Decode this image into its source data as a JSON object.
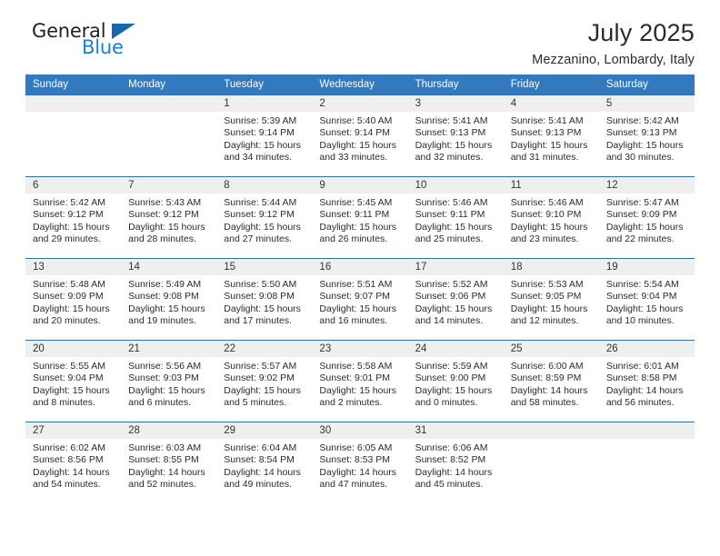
{
  "brand": {
    "name_top": "General",
    "name_bottom": "Blue",
    "triangle_color": "#1567b0",
    "blue_color": "#1c7fd0"
  },
  "header": {
    "title": "July 2025",
    "subtitle": "Mezzanino, Lombardy, Italy"
  },
  "theme": {
    "header_row_bg": "#3279be",
    "daynum_bg": "#efefef",
    "row_divider": "#2f6fb0"
  },
  "weekdays": [
    "Sunday",
    "Monday",
    "Tuesday",
    "Wednesday",
    "Thursday",
    "Friday",
    "Saturday"
  ],
  "weeks": [
    [
      {
        "day": "",
        "sunrise": "",
        "sunset": "",
        "daylight1": "",
        "daylight2": ""
      },
      {
        "day": "",
        "sunrise": "",
        "sunset": "",
        "daylight1": "",
        "daylight2": ""
      },
      {
        "day": "1",
        "sunrise": "Sunrise: 5:39 AM",
        "sunset": "Sunset: 9:14 PM",
        "daylight1": "Daylight: 15 hours",
        "daylight2": "and 34 minutes."
      },
      {
        "day": "2",
        "sunrise": "Sunrise: 5:40 AM",
        "sunset": "Sunset: 9:14 PM",
        "daylight1": "Daylight: 15 hours",
        "daylight2": "and 33 minutes."
      },
      {
        "day": "3",
        "sunrise": "Sunrise: 5:41 AM",
        "sunset": "Sunset: 9:13 PM",
        "daylight1": "Daylight: 15 hours",
        "daylight2": "and 32 minutes."
      },
      {
        "day": "4",
        "sunrise": "Sunrise: 5:41 AM",
        "sunset": "Sunset: 9:13 PM",
        "daylight1": "Daylight: 15 hours",
        "daylight2": "and 31 minutes."
      },
      {
        "day": "5",
        "sunrise": "Sunrise: 5:42 AM",
        "sunset": "Sunset: 9:13 PM",
        "daylight1": "Daylight: 15 hours",
        "daylight2": "and 30 minutes."
      }
    ],
    [
      {
        "day": "6",
        "sunrise": "Sunrise: 5:42 AM",
        "sunset": "Sunset: 9:12 PM",
        "daylight1": "Daylight: 15 hours",
        "daylight2": "and 29 minutes."
      },
      {
        "day": "7",
        "sunrise": "Sunrise: 5:43 AM",
        "sunset": "Sunset: 9:12 PM",
        "daylight1": "Daylight: 15 hours",
        "daylight2": "and 28 minutes."
      },
      {
        "day": "8",
        "sunrise": "Sunrise: 5:44 AM",
        "sunset": "Sunset: 9:12 PM",
        "daylight1": "Daylight: 15 hours",
        "daylight2": "and 27 minutes."
      },
      {
        "day": "9",
        "sunrise": "Sunrise: 5:45 AM",
        "sunset": "Sunset: 9:11 PM",
        "daylight1": "Daylight: 15 hours",
        "daylight2": "and 26 minutes."
      },
      {
        "day": "10",
        "sunrise": "Sunrise: 5:46 AM",
        "sunset": "Sunset: 9:11 PM",
        "daylight1": "Daylight: 15 hours",
        "daylight2": "and 25 minutes."
      },
      {
        "day": "11",
        "sunrise": "Sunrise: 5:46 AM",
        "sunset": "Sunset: 9:10 PM",
        "daylight1": "Daylight: 15 hours",
        "daylight2": "and 23 minutes."
      },
      {
        "day": "12",
        "sunrise": "Sunrise: 5:47 AM",
        "sunset": "Sunset: 9:09 PM",
        "daylight1": "Daylight: 15 hours",
        "daylight2": "and 22 minutes."
      }
    ],
    [
      {
        "day": "13",
        "sunrise": "Sunrise: 5:48 AM",
        "sunset": "Sunset: 9:09 PM",
        "daylight1": "Daylight: 15 hours",
        "daylight2": "and 20 minutes."
      },
      {
        "day": "14",
        "sunrise": "Sunrise: 5:49 AM",
        "sunset": "Sunset: 9:08 PM",
        "daylight1": "Daylight: 15 hours",
        "daylight2": "and 19 minutes."
      },
      {
        "day": "15",
        "sunrise": "Sunrise: 5:50 AM",
        "sunset": "Sunset: 9:08 PM",
        "daylight1": "Daylight: 15 hours",
        "daylight2": "and 17 minutes."
      },
      {
        "day": "16",
        "sunrise": "Sunrise: 5:51 AM",
        "sunset": "Sunset: 9:07 PM",
        "daylight1": "Daylight: 15 hours",
        "daylight2": "and 16 minutes."
      },
      {
        "day": "17",
        "sunrise": "Sunrise: 5:52 AM",
        "sunset": "Sunset: 9:06 PM",
        "daylight1": "Daylight: 15 hours",
        "daylight2": "and 14 minutes."
      },
      {
        "day": "18",
        "sunrise": "Sunrise: 5:53 AM",
        "sunset": "Sunset: 9:05 PM",
        "daylight1": "Daylight: 15 hours",
        "daylight2": "and 12 minutes."
      },
      {
        "day": "19",
        "sunrise": "Sunrise: 5:54 AM",
        "sunset": "Sunset: 9:04 PM",
        "daylight1": "Daylight: 15 hours",
        "daylight2": "and 10 minutes."
      }
    ],
    [
      {
        "day": "20",
        "sunrise": "Sunrise: 5:55 AM",
        "sunset": "Sunset: 9:04 PM",
        "daylight1": "Daylight: 15 hours",
        "daylight2": "and 8 minutes."
      },
      {
        "day": "21",
        "sunrise": "Sunrise: 5:56 AM",
        "sunset": "Sunset: 9:03 PM",
        "daylight1": "Daylight: 15 hours",
        "daylight2": "and 6 minutes."
      },
      {
        "day": "22",
        "sunrise": "Sunrise: 5:57 AM",
        "sunset": "Sunset: 9:02 PM",
        "daylight1": "Daylight: 15 hours",
        "daylight2": "and 5 minutes."
      },
      {
        "day": "23",
        "sunrise": "Sunrise: 5:58 AM",
        "sunset": "Sunset: 9:01 PM",
        "daylight1": "Daylight: 15 hours",
        "daylight2": "and 2 minutes."
      },
      {
        "day": "24",
        "sunrise": "Sunrise: 5:59 AM",
        "sunset": "Sunset: 9:00 PM",
        "daylight1": "Daylight: 15 hours",
        "daylight2": "and 0 minutes."
      },
      {
        "day": "25",
        "sunrise": "Sunrise: 6:00 AM",
        "sunset": "Sunset: 8:59 PM",
        "daylight1": "Daylight: 14 hours",
        "daylight2": "and 58 minutes."
      },
      {
        "day": "26",
        "sunrise": "Sunrise: 6:01 AM",
        "sunset": "Sunset: 8:58 PM",
        "daylight1": "Daylight: 14 hours",
        "daylight2": "and 56 minutes."
      }
    ],
    [
      {
        "day": "27",
        "sunrise": "Sunrise: 6:02 AM",
        "sunset": "Sunset: 8:56 PM",
        "daylight1": "Daylight: 14 hours",
        "daylight2": "and 54 minutes."
      },
      {
        "day": "28",
        "sunrise": "Sunrise: 6:03 AM",
        "sunset": "Sunset: 8:55 PM",
        "daylight1": "Daylight: 14 hours",
        "daylight2": "and 52 minutes."
      },
      {
        "day": "29",
        "sunrise": "Sunrise: 6:04 AM",
        "sunset": "Sunset: 8:54 PM",
        "daylight1": "Daylight: 14 hours",
        "daylight2": "and 49 minutes."
      },
      {
        "day": "30",
        "sunrise": "Sunrise: 6:05 AM",
        "sunset": "Sunset: 8:53 PM",
        "daylight1": "Daylight: 14 hours",
        "daylight2": "and 47 minutes."
      },
      {
        "day": "31",
        "sunrise": "Sunrise: 6:06 AM",
        "sunset": "Sunset: 8:52 PM",
        "daylight1": "Daylight: 14 hours",
        "daylight2": "and 45 minutes."
      },
      {
        "day": "",
        "sunrise": "",
        "sunset": "",
        "daylight1": "",
        "daylight2": ""
      },
      {
        "day": "",
        "sunrise": "",
        "sunset": "",
        "daylight1": "",
        "daylight2": ""
      }
    ]
  ]
}
